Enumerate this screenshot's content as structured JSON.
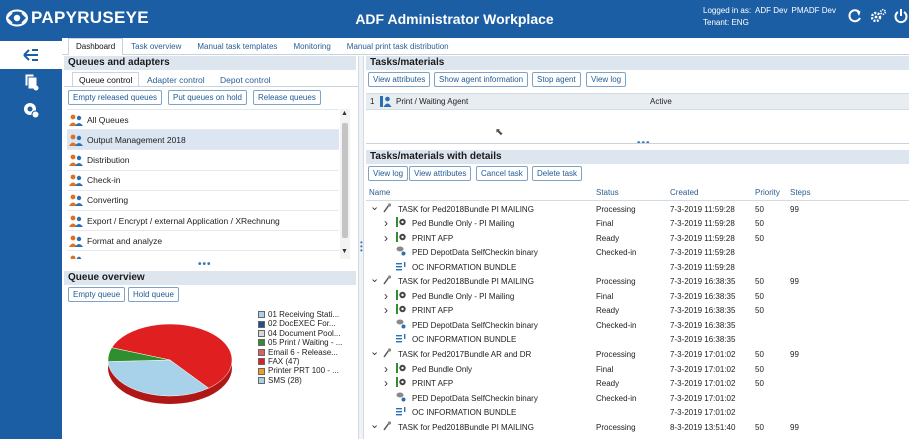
{
  "header": {
    "logo_text": "PAPYRUSEYE",
    "title": "ADF Administrator Workplace",
    "logged_in_label": "Logged in as:",
    "user_name": "ADF Dev",
    "role": "PMADF Dev",
    "tenant": "Tenant: ENG",
    "icons": [
      "refresh-icon",
      "settings-icon",
      "power-icon"
    ]
  },
  "rail": {
    "items": [
      "collapse-icon",
      "documents-icon",
      "settings-monitor-icon"
    ]
  },
  "tabs": [
    "Dashboard",
    "Task overview",
    "Manual task templates",
    "Monitoring",
    "Manual print task distribution"
  ],
  "queues_panel": {
    "title": "Queues and adapters",
    "subtabs": [
      "Queue control",
      "Adapter control",
      "Depot control"
    ],
    "buttons": [
      "Empty released queues",
      "Put queues on hold",
      "Release queues"
    ],
    "items": [
      "All Queues",
      "Output Management 2018",
      "Distribution",
      "Check-in",
      "Converting",
      "Export / Encrypt / external Application / XRechnung",
      "Format and analyze",
      ""
    ],
    "selected_index": 1
  },
  "overview_panel": {
    "title": "Queue overview",
    "buttons": [
      "Empty queue",
      "Hold queue"
    ],
    "legend": [
      {
        "label": "01 Receiving Stati...",
        "color": "#a8d1ea"
      },
      {
        "label": "02 DocEXEC For...",
        "color": "#1f4f8f"
      },
      {
        "label": "04 Document Pool...",
        "color": "#d9d9d9"
      },
      {
        "label": "05 Print / Waiting - ...",
        "color": "#2f8f2f"
      },
      {
        "label": "Email 6 - Release...",
        "color": "#e06060"
      },
      {
        "label": "FAX (47)",
        "color": "#e02020"
      },
      {
        "label": "Printer PRT 100 - ...",
        "color": "#f0a020"
      },
      {
        "label": "SMS (28)",
        "color": "#a8d1ea"
      }
    ],
    "chart_data": {
      "type": "pie",
      "categories": [
        "FAX",
        "SMS",
        "05 Print / Waiting"
      ],
      "values": [
        47,
        28,
        5
      ],
      "colors": [
        "#e02020",
        "#a8d1ea",
        "#2f8f2f"
      ]
    }
  },
  "tasks_panel": {
    "title": "Tasks/materials",
    "buttons": [
      "View attributes",
      "Show agent information",
      "Stop agent",
      "View log"
    ],
    "agent_row": {
      "num": "1",
      "col1": "Print / Waiting Agent",
      "col2": "Active"
    }
  },
  "details_panel": {
    "title": "Tasks/materials with details",
    "buttons": [
      "View log",
      "View attributes",
      "Cancel task",
      "Delete task"
    ],
    "columns": [
      "Name",
      "Status",
      "Created",
      "Priority",
      "Steps"
    ],
    "rows": [
      {
        "level": 0,
        "expander": "v",
        "icon": "task",
        "name": "TASK for Ped2018Bundle PI MAILING",
        "status": "Processing",
        "created": "7-3-2019 11:59:28",
        "priority": "50",
        "steps": "99"
      },
      {
        "level": 1,
        "expander": ">",
        "icon": "bundle",
        "name": "Ped Bundle Only - PI Mailing",
        "status": "Final",
        "created": "7-3-2019 11:59:28",
        "priority": "50",
        "steps": ""
      },
      {
        "level": 1,
        "expander": ">",
        "icon": "print",
        "name": "PRINT AFP",
        "status": "Ready",
        "created": "7-3-2019 11:59:28",
        "priority": "50",
        "steps": ""
      },
      {
        "level": 1,
        "expander": "",
        "icon": "depot",
        "name": "PED DepotData SelfCheckin binary",
        "status": "Checked-in",
        "created": "7-3-2019 11:59:28",
        "priority": "",
        "steps": ""
      },
      {
        "level": 1,
        "expander": "",
        "icon": "info",
        "name": "OC INFORMATION BUNDLE",
        "status": "",
        "created": "7-3-2019 11:59:28",
        "priority": "",
        "steps": ""
      },
      {
        "level": 0,
        "expander": "v",
        "icon": "task",
        "name": "TASK for Ped2018Bundle PI MAILING",
        "status": "Processing",
        "created": "7-3-2019 16:38:35",
        "priority": "50",
        "steps": "99"
      },
      {
        "level": 1,
        "expander": ">",
        "icon": "bundle",
        "name": "Ped Bundle Only - PI Mailing",
        "status": "Final",
        "created": "7-3-2019 16:38:35",
        "priority": "50",
        "steps": ""
      },
      {
        "level": 1,
        "expander": ">",
        "icon": "print",
        "name": "PRINT AFP",
        "status": "Ready",
        "created": "7-3-2019 16:38:35",
        "priority": "50",
        "steps": ""
      },
      {
        "level": 1,
        "expander": "",
        "icon": "depot",
        "name": "PED DepotData SelfCheckin binary",
        "status": "Checked-in",
        "created": "7-3-2019 16:38:35",
        "priority": "",
        "steps": ""
      },
      {
        "level": 1,
        "expander": "",
        "icon": "info",
        "name": "OC INFORMATION BUNDLE",
        "status": "",
        "created": "7-3-2019 16:38:35",
        "priority": "",
        "steps": ""
      },
      {
        "level": 0,
        "expander": "v",
        "icon": "task",
        "name": "TASK for Ped2017Bundle AR and DR",
        "status": "Processing",
        "created": "7-3-2019 17:01:02",
        "priority": "50",
        "steps": "99"
      },
      {
        "level": 1,
        "expander": ">",
        "icon": "bundle",
        "name": "Ped Bundle Only",
        "status": "Final",
        "created": "7-3-2019 17:01:02",
        "priority": "50",
        "steps": ""
      },
      {
        "level": 1,
        "expander": ">",
        "icon": "print",
        "name": "PRINT AFP",
        "status": "Ready",
        "created": "7-3-2019 17:01:02",
        "priority": "50",
        "steps": ""
      },
      {
        "level": 1,
        "expander": "",
        "icon": "depot",
        "name": "PED DepotData SelfCheckin binary",
        "status": "Checked-in",
        "created": "7-3-2019 17:01:02",
        "priority": "",
        "steps": ""
      },
      {
        "level": 1,
        "expander": "",
        "icon": "info",
        "name": "OC INFORMATION BUNDLE",
        "status": "",
        "created": "7-3-2019 17:01:02",
        "priority": "",
        "steps": ""
      },
      {
        "level": 0,
        "expander": "v",
        "icon": "task",
        "name": "TASK for Ped2018Bundle PI MAILING",
        "status": "Processing",
        "created": "8-3-2019 13:51:40",
        "priority": "50",
        "steps": "99"
      }
    ]
  }
}
